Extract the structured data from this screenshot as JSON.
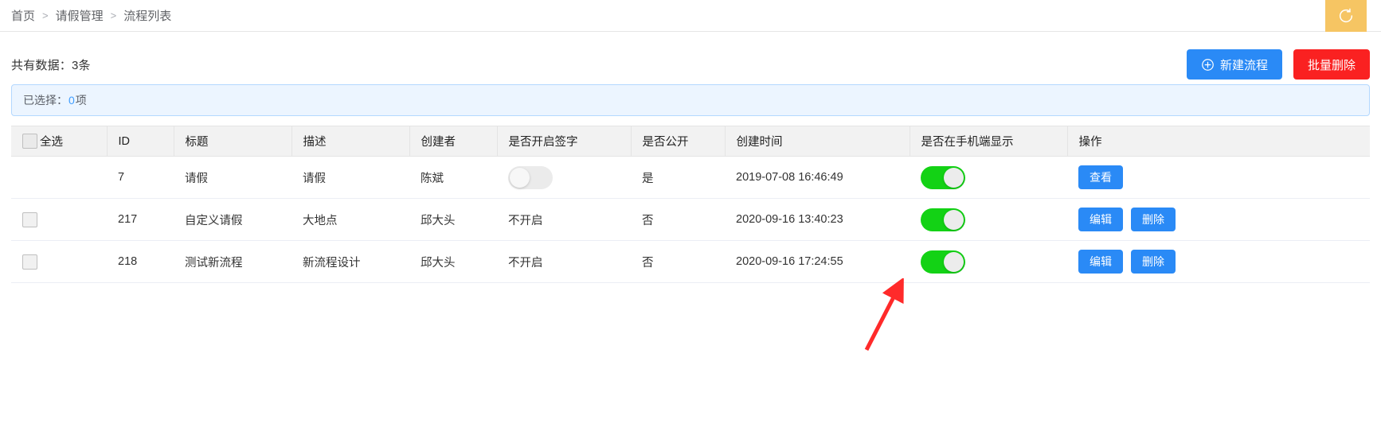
{
  "breadcrumb": {
    "items": [
      "首页",
      "请假管理",
      "流程列表"
    ],
    "separator": ">"
  },
  "header": {
    "refresh_icon": "refresh-icon",
    "refresh_bg": "#f6c563"
  },
  "toolbar": {
    "total_text": "共有数据：3条",
    "create_label": "新建流程",
    "create_icon": "plus-circle-icon",
    "create_color": "#2a8af6",
    "batch_delete_label": "批量删除",
    "batch_delete_color": "#fa2121"
  },
  "selection_alert": {
    "prefix": "已选择：",
    "count": "0",
    "suffix": "项",
    "accent": "#409eff"
  },
  "table": {
    "columns": [
      "全选",
      "ID",
      "标题",
      "描述",
      "创建者",
      "是否开启签字",
      "是否公开",
      "创建时间",
      "是否在手机端显示",
      "操作"
    ],
    "rows": [
      {
        "has_checkbox": false,
        "id": "7",
        "title": "请假",
        "desc": "请假",
        "creator": "陈斌",
        "sign": "",
        "sign_toggle": "off",
        "public": "是",
        "created_at": "2019-07-08 16:46:49",
        "mobile_toggle": "on",
        "actions": [
          "查看"
        ]
      },
      {
        "has_checkbox": true,
        "id": "217",
        "title": "自定义请假",
        "desc": "大地点",
        "creator": "邱大头",
        "sign": "不开启",
        "sign_toggle": null,
        "public": "否",
        "created_at": "2020-09-16 13:40:23",
        "mobile_toggle": "on",
        "actions": [
          "编辑",
          "删除"
        ]
      },
      {
        "has_checkbox": true,
        "id": "218",
        "title": "测试新流程",
        "desc": "新流程设计",
        "creator": "邱大头",
        "sign": "不开启",
        "sign_toggle": null,
        "public": "否",
        "created_at": "2020-09-16 17:24:55",
        "mobile_toggle": "on",
        "actions": [
          "编辑",
          "删除"
        ]
      }
    ]
  },
  "annotation": {
    "type": "arrow",
    "color": "#ff2a2a",
    "points_at": "mobile-display-toggle-row-3"
  }
}
